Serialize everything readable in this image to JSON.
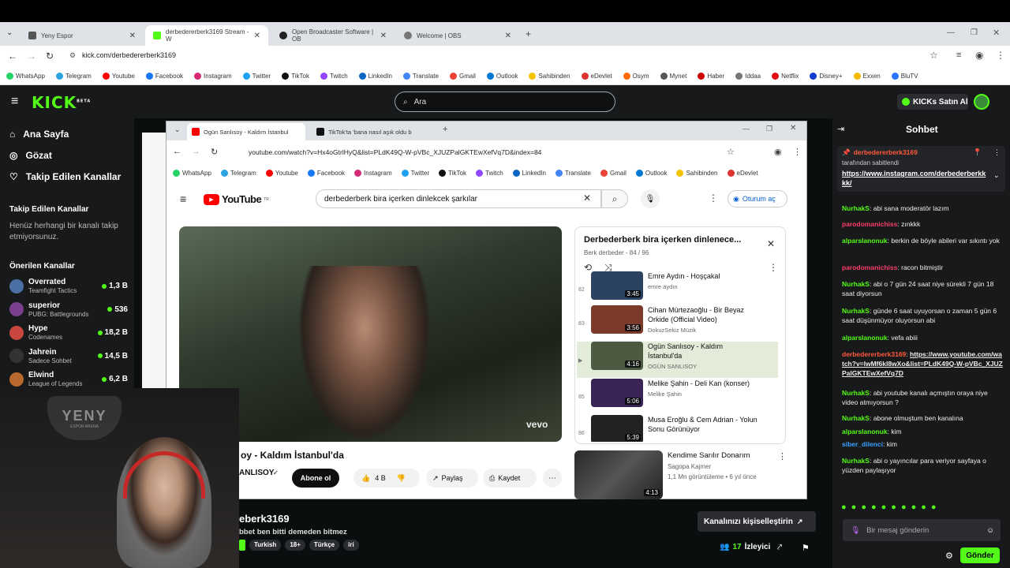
{
  "outer_tabs": [
    {
      "label": "Yeny Espor",
      "active": false
    },
    {
      "label": "derbedererberk3169 Stream - W",
      "active": true
    },
    {
      "label": "Open Broadcaster Software | OB",
      "active": false
    },
    {
      "label": "Welcome | OBS",
      "active": false
    }
  ],
  "address": "kick.com/derbedererberk3169",
  "bookmarks": [
    "WhatsApp",
    "Telegram",
    "Youtube",
    "Facebook",
    "Instagram",
    "Twitter",
    "TikTok",
    "Twitch",
    "LinkedIn",
    "Translate",
    "Gmail",
    "Outlook",
    "Sahibinden",
    "eDevlet",
    "Osym",
    "Mynet",
    "Haber",
    "Iddaa",
    "Netflix",
    "Disney+",
    "Exxen",
    "BluTV"
  ],
  "kick": {
    "logo": "KICK",
    "logo_badge": "BETA",
    "search_placeholder": "Ara",
    "kicks_button": "KICKs Satın Al",
    "nav": [
      "Ana Sayfa",
      "Gözat",
      "Takip Edilen Kanallar"
    ],
    "following_title": "Takip Edilen Kanallar",
    "following_empty": "Henüz herhangi bir kanalı takip etmiyorsunuz.",
    "recommended_title": "Önerilen Kanallar",
    "channels": [
      {
        "name": "Overrated",
        "game": "Teamfight Tactics",
        "viewers": "1,3 B",
        "color": "#4a6fa5"
      },
      {
        "name": "superior",
        "game": "PUBG: Battlegrounds",
        "viewers": "536",
        "color": "#7a3f8f"
      },
      {
        "name": "Hype",
        "game": "Codenames",
        "viewers": "18,2 B",
        "color": "#c7463d"
      },
      {
        "name": "Jahrein",
        "game": "Sadece Sohbet",
        "viewers": "14,5 B",
        "color": "#333"
      },
      {
        "name": "Elwind",
        "game": "League of Legends",
        "viewers": "6,2 B",
        "color": "#b86a2e"
      }
    ]
  },
  "inner": {
    "tabs": [
      "Ogün Sanlısoy - Kaldım İstanbul",
      "TikTok'ta 'bana nasıl aşık oldu b"
    ],
    "address": "youtube.com/watch?v=Hx4oGtrlHyQ&list=PLdK49Q-W-pVBc_XJUZPalGKTEwXefVq7D&index=84",
    "bookmarks": [
      "WhatsApp",
      "Telegram",
      "Youtube",
      "Facebook",
      "Instagram",
      "Twitter",
      "TikTok",
      "Twitch",
      "LinkedIn",
      "Translate",
      "Gmail",
      "Outlook",
      "Sahibinden",
      "eDevlet"
    ],
    "yt_logo": "YouTube",
    "yt_logo_sup": "TR",
    "yt_query": "derbederberk bira içerken dinlekcek şarkılar",
    "signin": "Oturum aç",
    "video_watermark": "vevo",
    "video_title": "oy - Kaldım İstanbul'da",
    "channel": "ANLISOY",
    "subscribe": "Abone ol",
    "likes": "4 B",
    "share": "Paylaş",
    "save": "Kaydet",
    "playlist": {
      "title": "Derbederberk bira içerken dinlenece...",
      "meta": "Berk derbeder - 84 / 96",
      "items": [
        {
          "num": "82",
          "title": "Emre Aydın - Hoşçakal",
          "channel": "emre aydın",
          "duration": "3:45",
          "color": "#2b4260"
        },
        {
          "num": "83",
          "title": "Cihan Mürtezaoğlu - Bir Beyaz Orkide (Official Video)",
          "channel": "DokuzSekiz Müzik",
          "duration": "3:56",
          "color": "#7c3a2a"
        },
        {
          "num": "▶",
          "title": "Ogün Sanlısoy - Kaldım İstanbul'da",
          "channel": "OGÜN SANLISOY",
          "duration": "4:16",
          "color": "#4b5a40"
        },
        {
          "num": "85",
          "title": "Melike Şahin - Deli Kan (konser)",
          "channel": "Melike Şahin",
          "duration": "5:06",
          "color": "#3a2355"
        },
        {
          "num": "86",
          "title": "Musa Eroğlu & Cem Adrian - Yolun Sonu Görünüyor",
          "channel": "",
          "duration": "5:39",
          "color": "#222"
        }
      ]
    },
    "rec": {
      "title": "Kendime Sarılır Donarım",
      "channel": "Sagopa Kajmer",
      "meta": "1,1 Mn görüntüleme • 6 yıl önce",
      "duration": "4:13"
    }
  },
  "stream_info": {
    "channel": "eberk3169",
    "title": "bbet ben bitti demeden bitmez",
    "tags": [
      "Turkish",
      "18+",
      "Türkçe",
      "iri"
    ],
    "customize": "Kanalınızı kişiselleştirin",
    "viewers": "17",
    "viewers_label": "İzleyici"
  },
  "chat": {
    "title": "Sohbet",
    "pinned_user": "derbedererberk3169",
    "pinned_by": "tarafından sabitlendi",
    "pinned_link": "https://www.instagram.com/derbederberkkkk/",
    "messages": [
      {
        "user": "NurhakS",
        "color": "#53fc18",
        "text": "abi sana moderatör lazım"
      },
      {
        "user": "parodomanichiss",
        "color": "#ff3b6b",
        "text": "zınkkk"
      },
      {
        "user": "alparslanonuk",
        "color": "#53fc18",
        "text": "berkin de böyle abileri var sıkıntı yok"
      },
      {
        "user": "parodomanichiss",
        "color": "#ff3b6b",
        "text": "racon bitmiştir"
      },
      {
        "user": "NurhakS",
        "color": "#53fc18",
        "text": "abi o 7 gün 24 saat niye sürekli 7 gün 18 saat diyorsun"
      },
      {
        "user": "NurhakS",
        "color": "#53fc18",
        "text": "günde 6 saat uyuyorsan o zaman 5 gün 6 saat düşünmüyor oluyorsun abi"
      },
      {
        "user": "alparslanonuk",
        "color": "#53fc18",
        "text": "vefa abiii"
      },
      {
        "user": "derbedererberk3169",
        "color": "#ff5a3c",
        "text": "https://www.youtube.com/watch?v=lwMf6kl8wXo&list=PLdK49Q-W-pVBc_XJUZPalGKTEwXefVq7D"
      },
      {
        "user": "NurhakS",
        "color": "#53fc18",
        "text": "abi youtube kanalı açmıştın oraya niye video atmıyorsun ?"
      },
      {
        "user": "NurhakS",
        "color": "#53fc18",
        "text": "abone olmuştum ben kanalına"
      },
      {
        "user": "alparslanonuk",
        "color": "#53fc18",
        "text": "kim"
      },
      {
        "user": "siber_dilenci",
        "color": "#3aa0ff",
        "text": "kim"
      },
      {
        "user": "NurhakS",
        "color": "#53fc18",
        "text": "abi o yayıncılar para veriyor sayfaya o yüzden paylaşıyor"
      }
    ],
    "input_placeholder": "Bir mesaj gönderin",
    "send": "Gönder"
  },
  "webcam_logo": "YENY",
  "webcam_sub": "ESPOR ARENA"
}
